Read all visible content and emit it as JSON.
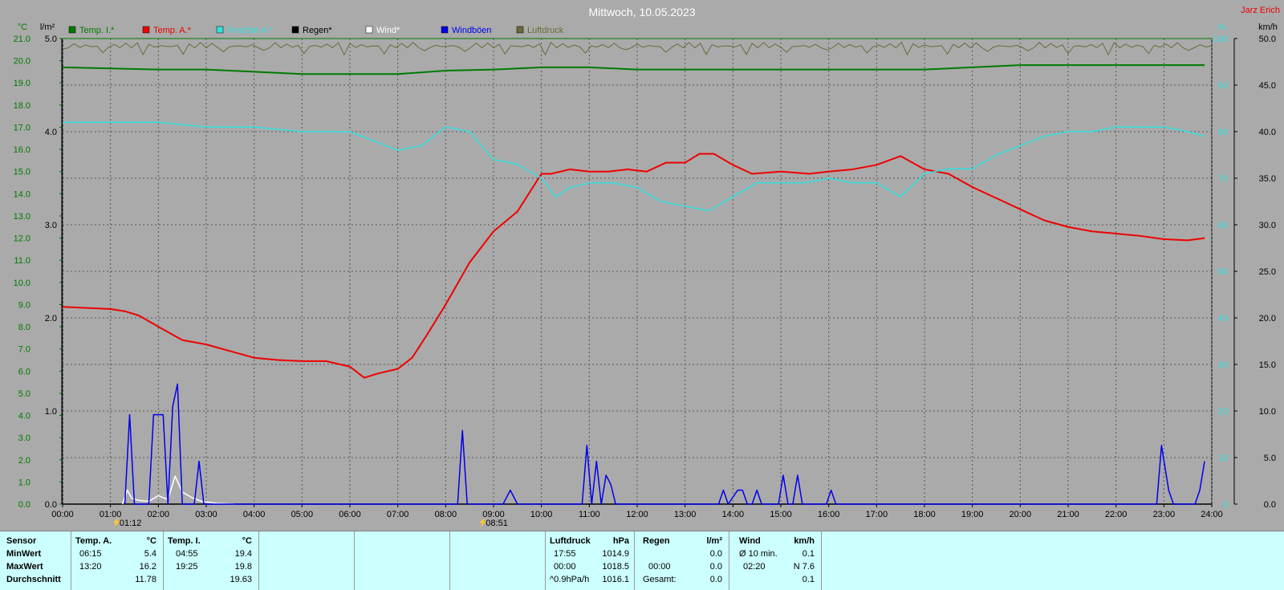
{
  "title": "Mittwoch, 10.05.2023",
  "author": "Jarz Erich",
  "colors": {
    "background": "#aaaaaa",
    "temp_inside": "#007a00",
    "temp_outside": "#ee0000",
    "humidity": "#33e0e0",
    "rain": "#000000",
    "wind": "#ffffff",
    "gusts": "#0000ee",
    "pressure": "#6b6b3a",
    "panel": "#ccffff"
  },
  "chart_data": {
    "type": "line",
    "title": "Mittwoch, 10.05.2023",
    "x_unit": "hours",
    "x_ticks": [
      "00:00",
      "01:00",
      "02:00",
      "03:00",
      "04:00",
      "05:00",
      "06:00",
      "07:00",
      "08:00",
      "09:00",
      "10:00",
      "11:00",
      "12:00",
      "13:00",
      "14:00",
      "15:00",
      "16:00",
      "17:00",
      "18:00",
      "19:00",
      "20:00",
      "21:00",
      "22:00",
      "23:00",
      "24:00"
    ],
    "axes": {
      "temp": {
        "unit": "°C",
        "range": [
          0,
          21
        ],
        "ticks": [
          "0.0",
          "1.0",
          "2.0",
          "3.0",
          "4.0",
          "5.0",
          "6.0",
          "7.0",
          "8.0",
          "9.0",
          "10.0",
          "11.0",
          "12.0",
          "13.0",
          "14.0",
          "15.0",
          "16.0",
          "17.0",
          "18.0",
          "19.0",
          "20.0",
          "21.0"
        ]
      },
      "rain": {
        "unit": "l/m²",
        "range": [
          0,
          5
        ],
        "ticks": [
          "0.0",
          "1.0",
          "2.0",
          "3.0",
          "4.0",
          "5.0"
        ]
      },
      "humidity": {
        "unit": "%",
        "range": [
          0,
          100
        ],
        "ticks": [
          "0",
          "10",
          "20",
          "30",
          "40",
          "50",
          "60",
          "70",
          "80",
          "90",
          "100"
        ]
      },
      "wind": {
        "unit": "km/h",
        "range": [
          0,
          50
        ],
        "ticks": [
          "0.0",
          "5.0",
          "10.0",
          "15.0",
          "20.0",
          "25.0",
          "30.0",
          "35.0",
          "40.0",
          "45.0",
          "50.0"
        ]
      }
    },
    "grid": true,
    "legend_position": "top-left",
    "markers": [
      {
        "label": "01:12",
        "x": 1.2
      },
      {
        "label": "08:51",
        "x": 8.85
      }
    ],
    "series": [
      {
        "name": "Temp. I.*",
        "axis": "temp",
        "color": "#007a00",
        "x": [
          0,
          1,
          2,
          3,
          4,
          5,
          6,
          7,
          8,
          9,
          10,
          11,
          12,
          13,
          14,
          15,
          16,
          17,
          18,
          19,
          20,
          21,
          22,
          23,
          23.85
        ],
        "y": [
          19.7,
          19.65,
          19.6,
          19.6,
          19.5,
          19.4,
          19.4,
          19.4,
          19.55,
          19.6,
          19.7,
          19.7,
          19.6,
          19.6,
          19.6,
          19.6,
          19.6,
          19.6,
          19.6,
          19.7,
          19.8,
          19.8,
          19.8,
          19.8,
          19.8
        ]
      },
      {
        "name": "Temp. A.*",
        "axis": "temp",
        "color": "#ee0000",
        "x": [
          0,
          0.5,
          1,
          1.3,
          1.6,
          2,
          2.5,
          3,
          3.5,
          4,
          4.5,
          5,
          5.5,
          6,
          6.3,
          6.6,
          7,
          7.3,
          7.6,
          8,
          8.5,
          9,
          9.5,
          10,
          10.2,
          10.6,
          11,
          11.4,
          11.8,
          12.2,
          12.6,
          13,
          13.3,
          13.6,
          14,
          14.4,
          15,
          15.6,
          16,
          16.5,
          17,
          17.5,
          18,
          18.5,
          19,
          19.5,
          20,
          20.5,
          21,
          21.5,
          22,
          22.5,
          23,
          23.5,
          23.85
        ],
        "y": [
          8.9,
          8.85,
          8.8,
          8.7,
          8.5,
          8.0,
          7.4,
          7.2,
          6.9,
          6.6,
          6.5,
          6.45,
          6.45,
          6.2,
          5.7,
          5.9,
          6.1,
          6.6,
          7.6,
          9.0,
          10.9,
          12.3,
          13.2,
          14.9,
          14.9,
          15.1,
          15.0,
          15.0,
          15.1,
          15.0,
          15.4,
          15.4,
          15.8,
          15.8,
          15.3,
          14.9,
          15.0,
          14.9,
          15.0,
          15.1,
          15.3,
          15.7,
          15.1,
          14.9,
          14.3,
          13.8,
          13.3,
          12.8,
          12.5,
          12.3,
          12.2,
          12.1,
          11.95,
          11.9,
          12.0
        ]
      },
      {
        "name": "Feuchte A.*",
        "axis": "humidity",
        "color": "#33e0e0",
        "x": [
          0,
          1,
          2,
          3,
          4,
          5,
          6,
          6.5,
          7,
          7.5,
          8,
          8.5,
          9,
          9.5,
          10,
          10.3,
          10.6,
          11,
          11.5,
          12,
          12.5,
          13,
          13.5,
          14,
          14.5,
          15,
          15.5,
          16,
          16.5,
          17,
          17.5,
          18,
          18.5,
          19,
          19.5,
          20,
          20.5,
          21,
          21.5,
          22,
          22.5,
          23,
          23.5,
          23.85
        ],
        "y": [
          82,
          82,
          82,
          81,
          81,
          80,
          80,
          78,
          76,
          77,
          81,
          80,
          74,
          73,
          70,
          66,
          68,
          69,
          69,
          68,
          65,
          64,
          63,
          66,
          69,
          69,
          69,
          70,
          69,
          69,
          66,
          71,
          72,
          72,
          75,
          77,
          79,
          80,
          80,
          81,
          81,
          81,
          80,
          79
        ]
      },
      {
        "name": "Regen*",
        "axis": "rain",
        "color": "#000000",
        "x": [
          0,
          24
        ],
        "y": [
          0,
          0
        ]
      },
      {
        "name": "Wind*",
        "axis": "wind",
        "color": "#ffffff",
        "x": [
          1.25,
          1.35,
          1.45,
          1.6,
          1.8,
          2,
          2.2,
          2.35,
          2.5,
          2.7,
          2.9,
          3.2,
          3.6
        ],
        "y": [
          0,
          1.5,
          0.6,
          0.4,
          0.3,
          0.9,
          0.5,
          3.0,
          1.3,
          0.7,
          0.3,
          0.1,
          0
        ]
      },
      {
        "name": "Windböen",
        "axis": "wind",
        "color": "#0000ee",
        "x": [
          1.3,
          1.4,
          1.5,
          1.8,
          1.9,
          2.1,
          2.2,
          2.3,
          2.4,
          2.5,
          2.75,
          2.85,
          2.95,
          8.25,
          8.35,
          8.45,
          9.2,
          9.35,
          9.5,
          10.85,
          10.95,
          11.05,
          11.15,
          11.25,
          11.35,
          11.45,
          11.55,
          11.65,
          13.7,
          13.8,
          13.9,
          14.1,
          14.2,
          14.3,
          14.4,
          14.5,
          14.6,
          14.95,
          15.05,
          15.15,
          15.25,
          15.35,
          15.45,
          15.95,
          16.05,
          16.15,
          22.85,
          22.95,
          23.1,
          23.2,
          23.65,
          23.75,
          23.85
        ],
        "y": [
          0,
          9.6,
          0,
          0,
          9.6,
          9.6,
          0,
          10.5,
          12.9,
          0,
          0,
          4.6,
          0,
          0,
          7.9,
          0,
          0,
          1.5,
          0,
          0,
          6.3,
          0,
          4.6,
          0,
          3.1,
          2.1,
          0,
          0,
          0,
          1.5,
          0,
          1.5,
          1.5,
          0,
          0,
          1.5,
          0,
          0,
          3.1,
          0,
          0,
          3.1,
          0,
          0,
          1.5,
          0,
          0,
          6.3,
          1.5,
          0,
          0,
          1.5,
          4.6
        ]
      },
      {
        "name": "Luftdruck",
        "axis": "humidity",
        "color": "#6b6b3a",
        "x": [],
        "y": []
      }
    ]
  },
  "legend": [
    {
      "name": "Temp. I.*",
      "color": "#007a00"
    },
    {
      "name": "Temp. A.*",
      "color": "#ee0000"
    },
    {
      "name": "Feuchte A.*",
      "color": "#33e0e0"
    },
    {
      "name": "Regen*",
      "color": "#000000"
    },
    {
      "name": "Wind*",
      "color": "#ffffff"
    },
    {
      "name": "Windböen",
      "color": "#0000ee"
    },
    {
      "name": "Luftdruck",
      "color": "#6b6b3a"
    }
  ],
  "panel": {
    "sensor": {
      "header": "Sensor",
      "min": "MinWert",
      "max": "MaxWert",
      "avg": "Durchschnitt"
    },
    "temp_a": {
      "header": "Temp. A.",
      "unit": "°C",
      "min_time": "06:15",
      "min_val": "5.4",
      "max_time": "13:20",
      "max_val": "16.2",
      "avg": "11.78"
    },
    "temp_i": {
      "header": "Temp. I.",
      "unit": "°C",
      "min_time": "04:55",
      "min_val": "19.4",
      "max_time": "19:25",
      "max_val": "19.8",
      "avg": "19.63"
    },
    "pressure": {
      "header": "Luftdruck",
      "unit": "hPa",
      "min_time": "17:55",
      "min_val": "1014.9",
      "max_time": "00:00",
      "max_val": "1018.5",
      "avg_label": "^0.9hPa/h",
      "avg": "1016.1"
    },
    "rain": {
      "header": "Regen",
      "unit": "l/m²",
      "max_time": "00:00",
      "max_val": "0.0",
      "total_label": "Gesamt:",
      "total": "0.0",
      "min_val": "0.0"
    },
    "wind": {
      "header": "Wind",
      "unit": "km/h",
      "min_label": "Ø 10 min.",
      "min_val": "0.1",
      "max_time": "02:20",
      "max_val": "N 7.6",
      "avg": "0.1"
    }
  }
}
